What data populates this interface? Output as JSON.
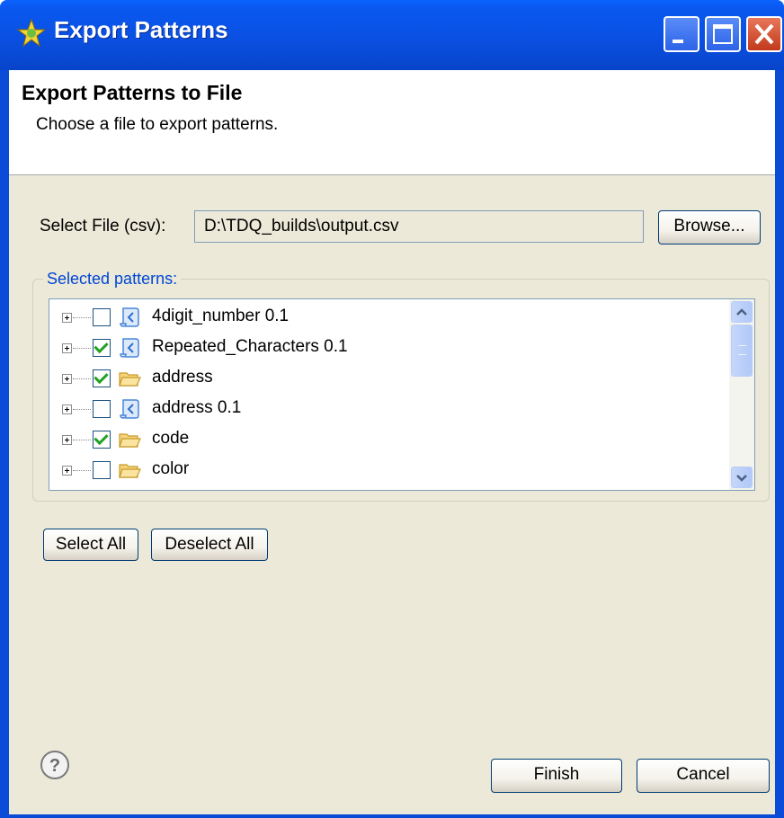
{
  "window": {
    "title": "Export Patterns"
  },
  "header": {
    "title": "Export Patterns to File",
    "description": "Choose a file to export patterns."
  },
  "file": {
    "label": "Select File (csv):",
    "value": "D:\\TDQ_builds\\output.csv",
    "browse_label": "Browse..."
  },
  "patterns": {
    "group_label": "Selected patterns:",
    "items": [
      {
        "label": "4digit_number 0.1",
        "checked": false,
        "icon": "pattern-icon"
      },
      {
        "label": "Repeated_Characters 0.1",
        "checked": true,
        "icon": "pattern-icon"
      },
      {
        "label": "address",
        "checked": true,
        "icon": "folder-icon"
      },
      {
        "label": "address 0.1",
        "checked": false,
        "icon": "pattern-icon"
      },
      {
        "label": "code",
        "checked": true,
        "icon": "folder-icon"
      },
      {
        "label": "color",
        "checked": false,
        "icon": "folder-icon"
      }
    ]
  },
  "selection_buttons": {
    "select_all": "Select All",
    "deselect_all": "Deselect All"
  },
  "footer": {
    "finish": "Finish",
    "cancel": "Cancel"
  },
  "colors": {
    "titlebar": "#0a50e2",
    "dialog_bg": "#ece9d8",
    "group_label": "#0046d5",
    "check": "#21a121"
  }
}
